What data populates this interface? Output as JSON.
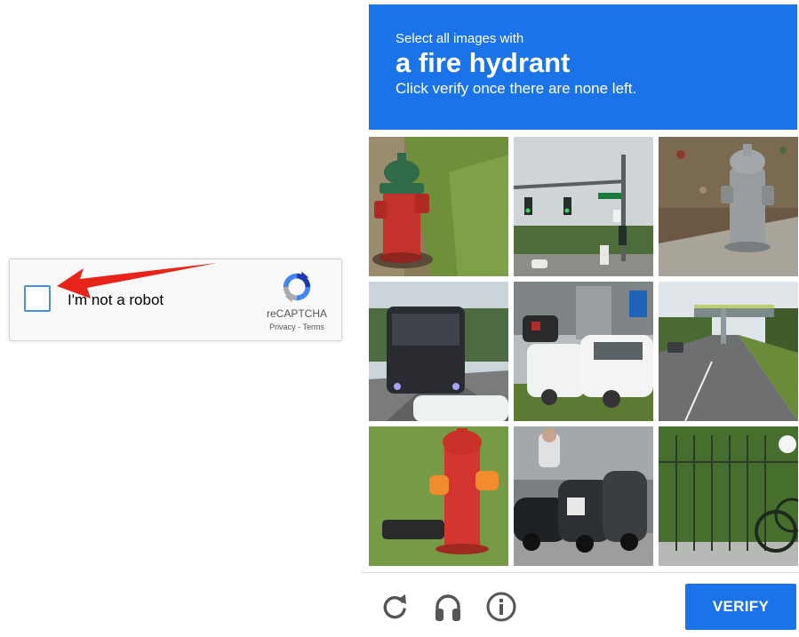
{
  "widget": {
    "checkbox_label": "I'm not a robot",
    "brand_name": "reCAPTCHA",
    "privacy_link": "Privacy",
    "links_separator": "-",
    "terms_link": "Terms",
    "checked": false,
    "logo_icon": "recaptcha-logo-icon"
  },
  "challenge": {
    "instruction_line1": "Select all images with",
    "target_object": "a fire hydrant",
    "instruction_line3": "Click verify once there are none left.",
    "tiles": [
      {
        "subject": "red fire hydrant with green cap on grass"
      },
      {
        "subject": "street traffic lights with signs"
      },
      {
        "subject": "grey fire hydrant on dirt"
      },
      {
        "subject": "dark bus on road"
      },
      {
        "subject": "white cars parked with motorcycles"
      },
      {
        "subject": "road with pedestrian bridge"
      },
      {
        "subject": "red fire hydrant on grass"
      },
      {
        "subject": "parked scooters and motorcycles"
      },
      {
        "subject": "green fence with bicycle"
      }
    ],
    "verify_label": "VERIFY",
    "tools": [
      "reload-icon",
      "audio-challenge-icon",
      "info-icon"
    ]
  },
  "colors": {
    "header_blue": "#1a73e8",
    "checkbox_border": "#4a90e2",
    "arrow_red": "#e8231a"
  }
}
